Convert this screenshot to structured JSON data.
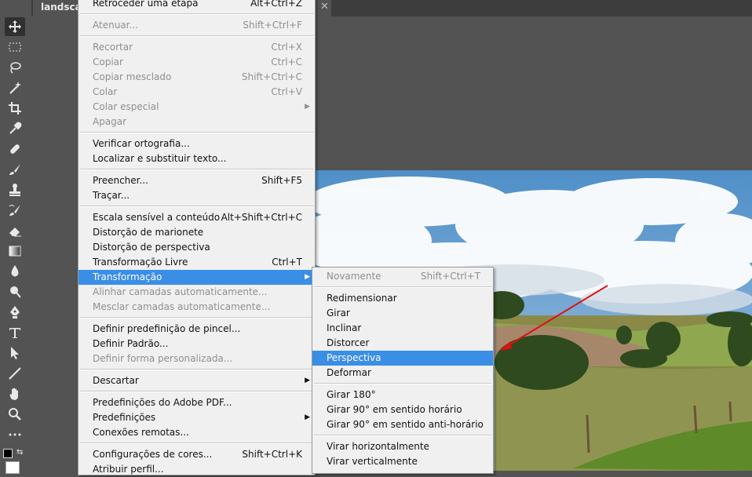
{
  "tab": {
    "title": "landscape"
  },
  "tools": [
    "move-icon",
    "marquee-icon",
    "lasso-icon",
    "magic-wand-icon",
    "crop-icon",
    "eyedropper-icon",
    "healing-brush-icon",
    "brush-icon",
    "clone-stamp-icon",
    "history-brush-icon",
    "eraser-icon",
    "gradient-icon",
    "blur-icon",
    "dodge-icon",
    "pen-icon",
    "type-icon",
    "path-select-icon",
    "line-icon",
    "hand-icon",
    "zoom-icon",
    "more-tools-icon"
  ],
  "edit_menu": {
    "items": [
      {
        "label": "Retroceder uma etapa",
        "shortcut": "Alt+Ctrl+Z",
        "disabled": false
      },
      {
        "label": "Atenuar...",
        "shortcut": "Shift+Ctrl+F",
        "disabled": true
      },
      {
        "label": "Recortar",
        "shortcut": "Ctrl+X",
        "disabled": true
      },
      {
        "label": "Copiar",
        "shortcut": "Ctrl+C",
        "disabled": true
      },
      {
        "label": "Copiar mesclado",
        "shortcut": "Shift+Ctrl+C",
        "disabled": true
      },
      {
        "label": "Colar",
        "shortcut": "Ctrl+V",
        "disabled": true
      },
      {
        "label": "Colar especial",
        "shortcut": "",
        "disabled": true
      },
      {
        "label": "Apagar",
        "shortcut": "",
        "disabled": true
      },
      {
        "label": "Verificar ortografia...",
        "shortcut": "",
        "disabled": false
      },
      {
        "label": "Localizar e substituir texto...",
        "shortcut": "",
        "disabled": false
      },
      {
        "label": "Preencher...",
        "shortcut": "Shift+F5",
        "disabled": false
      },
      {
        "label": "Traçar...",
        "shortcut": "",
        "disabled": false
      },
      {
        "label": "Escala sensível a conteúdo",
        "shortcut": "Alt+Shift+Ctrl+C",
        "disabled": false
      },
      {
        "label": "Distorção de marionete",
        "shortcut": "",
        "disabled": false
      },
      {
        "label": "Distorção de perspectiva",
        "shortcut": "",
        "disabled": false
      },
      {
        "label": "Transformação Livre",
        "shortcut": "Ctrl+T",
        "disabled": false
      },
      {
        "label": "Transformação",
        "shortcut": "",
        "disabled": false
      },
      {
        "label": "Alinhar camadas automaticamente...",
        "shortcut": "",
        "disabled": true
      },
      {
        "label": "Mesclar camadas automaticamente...",
        "shortcut": "",
        "disabled": true
      },
      {
        "label": "Definir predefinição de pincel...",
        "shortcut": "",
        "disabled": false
      },
      {
        "label": "Definir Padrão...",
        "shortcut": "",
        "disabled": false
      },
      {
        "label": "Definir forma personalizada...",
        "shortcut": "",
        "disabled": true
      },
      {
        "label": "Descartar",
        "shortcut": "",
        "disabled": false
      },
      {
        "label": "Predefinições do Adobe PDF...",
        "shortcut": "",
        "disabled": false
      },
      {
        "label": "Predefinições",
        "shortcut": "",
        "disabled": false
      },
      {
        "label": "Conexões remotas...",
        "shortcut": "",
        "disabled": false
      },
      {
        "label": "Configurações de cores...",
        "shortcut": "Shift+Ctrl+K",
        "disabled": false
      },
      {
        "label": "Atribuir perfil...",
        "shortcut": "",
        "disabled": false
      }
    ]
  },
  "transform_submenu": {
    "items": [
      {
        "label": "Novamente",
        "shortcut": "Shift+Ctrl+T",
        "disabled": true
      },
      {
        "label": "Redimensionar",
        "shortcut": ""
      },
      {
        "label": "Girar",
        "shortcut": ""
      },
      {
        "label": "Inclinar",
        "shortcut": ""
      },
      {
        "label": "Distorcer",
        "shortcut": ""
      },
      {
        "label": "Perspectiva",
        "shortcut": ""
      },
      {
        "label": "Deformar",
        "shortcut": ""
      },
      {
        "label": "Girar 180°",
        "shortcut": ""
      },
      {
        "label": "Girar 90° em sentido horário",
        "shortcut": ""
      },
      {
        "label": "Girar 90° em sentido anti-horário",
        "shortcut": ""
      },
      {
        "label": "Virar horizontalmente",
        "shortcut": ""
      },
      {
        "label": "Virar verticalmente",
        "shortcut": ""
      }
    ]
  },
  "colors": {
    "highlight": "#3a8ee6",
    "menu_bg": "#f0f0f0",
    "workspace": "#535353",
    "arrow": "#e01010"
  }
}
